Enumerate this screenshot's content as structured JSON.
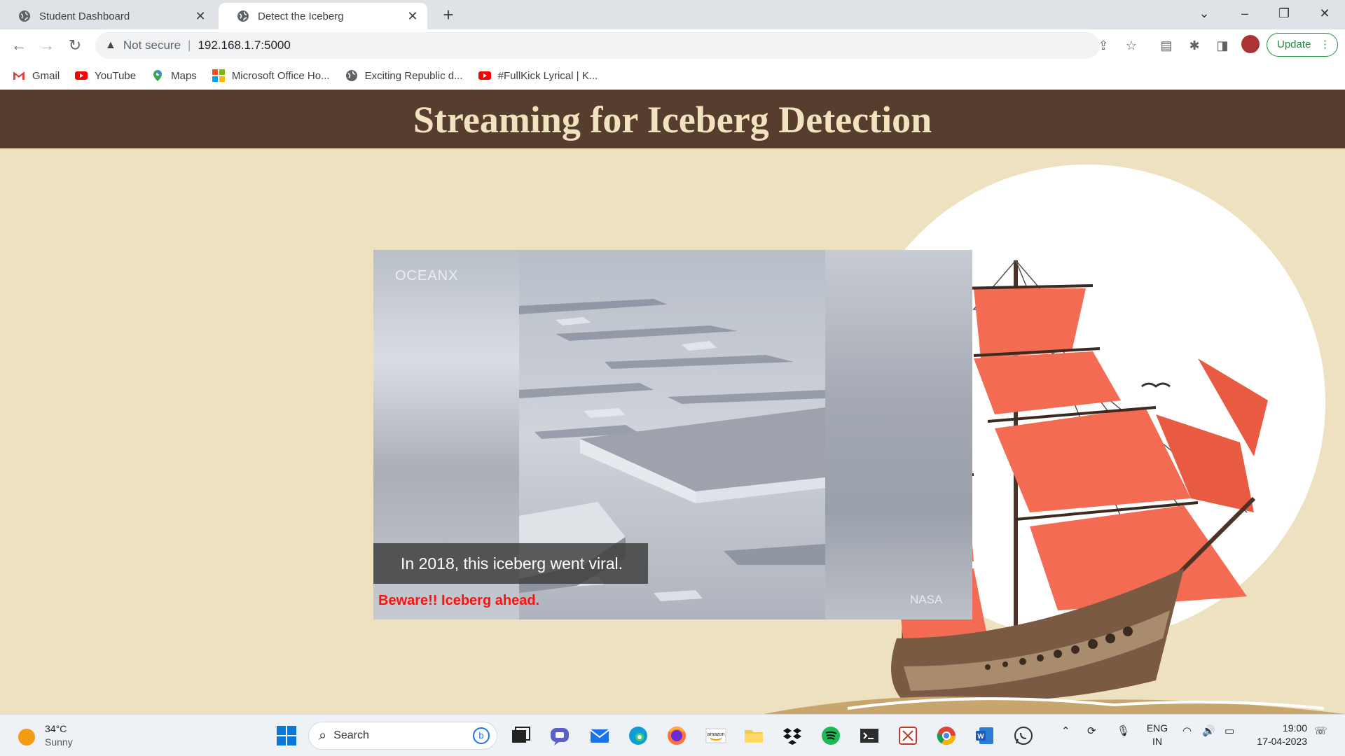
{
  "browser": {
    "tabs": [
      {
        "title": "Student Dashboard",
        "active": false
      },
      {
        "title": "Detect the Iceberg",
        "active": true
      }
    ],
    "address": {
      "security_label": "Not secure",
      "url": "192.168.1.7:5000"
    },
    "update_label": "Update",
    "bookmarks": [
      {
        "label": "Gmail",
        "icon": "gmail-icon"
      },
      {
        "label": "YouTube",
        "icon": "youtube-icon"
      },
      {
        "label": "Maps",
        "icon": "maps-icon"
      },
      {
        "label": "Microsoft Office Ho...",
        "icon": "office-icon"
      },
      {
        "label": "Exciting Republic d...",
        "icon": "globe-icon"
      },
      {
        "label": "#FullKick Lyrical | K...",
        "icon": "youtube-icon"
      }
    ]
  },
  "page": {
    "heading": "Streaming for Iceberg Detection",
    "video": {
      "watermark": "OCEANX",
      "caption": "In 2018, this iceberg went viral.",
      "alert": "Beware!! Iceberg ahead.",
      "credit": "NASA"
    }
  },
  "taskbar": {
    "weather": {
      "temp": "34°C",
      "condition": "Sunny"
    },
    "search_placeholder": "Search",
    "language": {
      "line1": "ENG",
      "line2": "IN"
    },
    "clock": {
      "time": "19:00",
      "date": "17-04-2023"
    }
  },
  "colors": {
    "header_bg": "#563d2e",
    "header_text": "#f2e3c0",
    "page_bg": "#ede1bf",
    "alert_text": "#ff1010",
    "sail": "#f26b52"
  }
}
